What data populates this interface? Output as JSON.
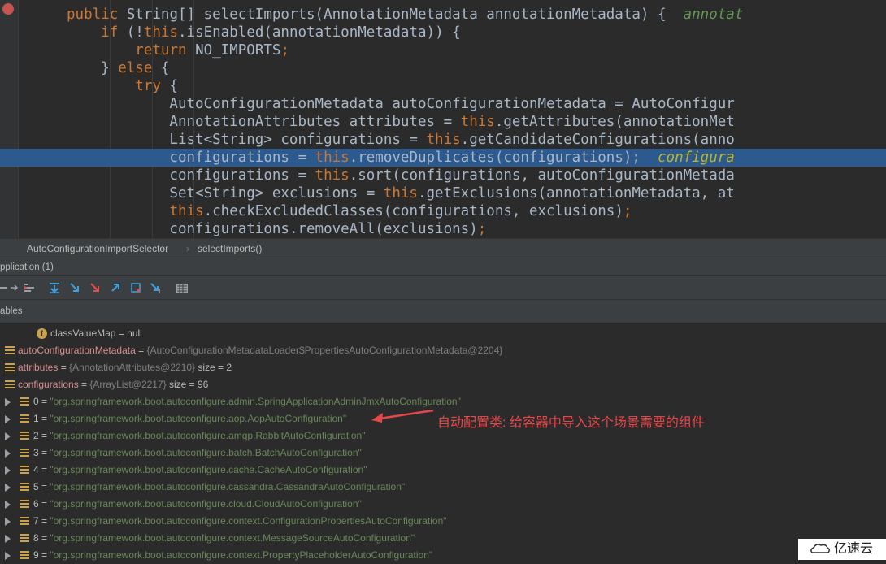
{
  "editor": {
    "lines": [
      {
        "parts": [
          [
            "kw",
            "public "
          ],
          [
            "",
            "String[] selectImports(AnnotationMetadata annotationMetadata) {  "
          ],
          [
            "ann",
            "annotat"
          ]
        ]
      },
      {
        "parts": [
          [
            "",
            "    "
          ],
          [
            "kw",
            "if "
          ],
          [
            "",
            "(!"
          ],
          [
            "kw",
            "this"
          ],
          [
            "",
            ".isEnabled(annotationMetadata)) {"
          ]
        ]
      },
      {
        "parts": [
          [
            "",
            "        "
          ],
          [
            "kw",
            "return "
          ],
          [
            "",
            "NO_IMPORTS"
          ],
          [
            "kw",
            ";"
          ]
        ]
      },
      {
        "parts": [
          [
            "",
            "    } "
          ],
          [
            "kw",
            "else "
          ],
          [
            "",
            "{"
          ]
        ]
      },
      {
        "parts": [
          [
            "",
            "        "
          ],
          [
            "kw",
            "try "
          ],
          [
            "",
            "{"
          ]
        ]
      },
      {
        "parts": [
          [
            "",
            "            AutoConfigurationMetadata autoConfigurationMetadata = AutoConfigur"
          ]
        ]
      },
      {
        "parts": [
          [
            "",
            "            AnnotationAttributes attributes = "
          ],
          [
            "kw",
            "this"
          ],
          [
            "",
            ".getAttributes(annotationMet"
          ]
        ]
      },
      {
        "parts": [
          [
            "",
            "            List<String> configurations = "
          ],
          [
            "kw",
            "this"
          ],
          [
            "",
            ".getCandidateConfigurations(anno"
          ]
        ]
      },
      {
        "parts": [
          [
            "",
            "            configurations = "
          ],
          [
            "kw",
            "this"
          ],
          [
            "",
            ".removeDuplicates(configurations);  "
          ],
          [
            "cmt",
            "configura"
          ]
        ]
      },
      {
        "parts": [
          [
            "",
            "            configurations = "
          ],
          [
            "kw",
            "this"
          ],
          [
            "",
            ".sort(configurations, autoConfigurationMetada"
          ]
        ]
      },
      {
        "parts": [
          [
            "",
            "            Set<String> exclusions = "
          ],
          [
            "kw",
            "this"
          ],
          [
            "",
            ".getExclusions(annotationMetadata, at"
          ]
        ]
      },
      {
        "parts": [
          [
            "",
            "            "
          ],
          [
            "kw",
            "this"
          ],
          [
            "",
            ".checkExcludedClasses(configurations, exclusions)"
          ],
          [
            "kw",
            ";"
          ]
        ]
      },
      {
        "parts": [
          [
            "",
            "            configurations.removeAll(exclusions)"
          ],
          [
            "kw",
            ";"
          ]
        ]
      }
    ]
  },
  "breadcrumb": {
    "class_name": "AutoConfigurationImportSelector",
    "separator": "›",
    "method": "selectImports()"
  },
  "debug": {
    "title": "pplication (1)",
    "variables_label": "ables"
  },
  "variables": [
    {
      "kind": "field",
      "name": "classValueMap",
      "eq": " = ",
      "value": "null"
    },
    {
      "kind": "obj",
      "name": "autoConfigurationMetadata",
      "eq": " = ",
      "ref": "{AutoConfigurationMetadataLoader$PropertiesAutoConfigurationMetadata@2204}"
    },
    {
      "kind": "obj",
      "name": "attributes",
      "eq": " = ",
      "ref": "{AnnotationAttributes@2210}",
      "size": "  size = 2"
    },
    {
      "kind": "obj",
      "name": "configurations",
      "eq": " = ",
      "ref": "{ArrayList@2217}",
      "size": "  size = 96"
    },
    {
      "kind": "item",
      "idx": "0",
      "eq": " = ",
      "str": "\"org.springframework.boot.autoconfigure.admin.SpringApplicationAdminJmxAutoConfiguration\""
    },
    {
      "kind": "item",
      "idx": "1",
      "eq": " = ",
      "str": "\"org.springframework.boot.autoconfigure.aop.AopAutoConfiguration\""
    },
    {
      "kind": "item",
      "idx": "2",
      "eq": " = ",
      "str": "\"org.springframework.boot.autoconfigure.amqp.RabbitAutoConfiguration\""
    },
    {
      "kind": "item",
      "idx": "3",
      "eq": " = ",
      "str": "\"org.springframework.boot.autoconfigure.batch.BatchAutoConfiguration\""
    },
    {
      "kind": "item",
      "idx": "4",
      "eq": " = ",
      "str": "\"org.springframework.boot.autoconfigure.cache.CacheAutoConfiguration\""
    },
    {
      "kind": "item",
      "idx": "5",
      "eq": " = ",
      "str": "\"org.springframework.boot.autoconfigure.cassandra.CassandraAutoConfiguration\""
    },
    {
      "kind": "item",
      "idx": "6",
      "eq": " = ",
      "str": "\"org.springframework.boot.autoconfigure.cloud.CloudAutoConfiguration\""
    },
    {
      "kind": "item",
      "idx": "7",
      "eq": " = ",
      "str": "\"org.springframework.boot.autoconfigure.context.ConfigurationPropertiesAutoConfiguration\""
    },
    {
      "kind": "item",
      "idx": "8",
      "eq": " = ",
      "str": "\"org.springframework.boot.autoconfigure.context.MessageSourceAutoConfiguration\""
    },
    {
      "kind": "item",
      "idx": "9",
      "eq": " = ",
      "str": "\"org.springframework.boot.autoconfigure.context.PropertyPlaceholderAutoConfiguration\""
    }
  ],
  "annotation": {
    "text": "自动配置类: 给容器中导入这个场景需要的组件"
  },
  "watermark": {
    "text": "亿速云"
  },
  "colors": {
    "keyword": "#cc7832",
    "highlight": "#2d5a8e",
    "annotation": "#e8474a"
  }
}
